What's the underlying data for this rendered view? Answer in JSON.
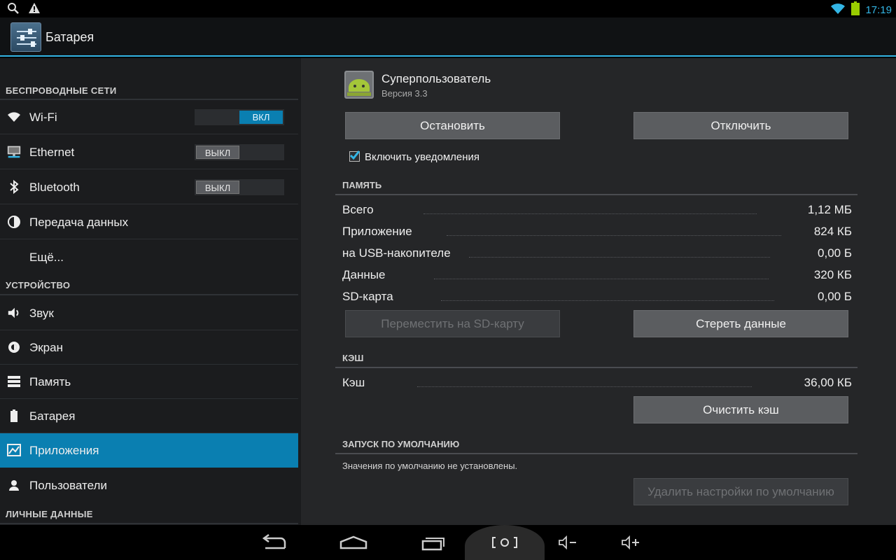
{
  "status_bar": {
    "left_icons": [
      "search-icon",
      "warning-icon"
    ],
    "right_icons": [
      "wifi-icon",
      "battery-icon"
    ],
    "time": "17:19",
    "accent": "#33b5e5"
  },
  "action_bar": {
    "title": "Батарея",
    "icon": "settings-sliders-icon"
  },
  "sidebar": {
    "sections": {
      "wireless": "БЕСПРОВОДНЫЕ СЕТИ",
      "device": "УСТРОЙСТВО",
      "personal": "ЛИЧНЫЕ ДАННЫЕ"
    },
    "items": [
      {
        "label": "Wi-Fi",
        "icon": "wifi-icon",
        "toggle": "ВКЛ",
        "toggle_state": "on"
      },
      {
        "label": "Ethernet",
        "icon": "ethernet-icon",
        "toggle": "ВЫКЛ",
        "toggle_state": "off"
      },
      {
        "label": "Bluetooth",
        "icon": "bluetooth-icon",
        "toggle": "ВЫКЛ",
        "toggle_state": "off"
      },
      {
        "label": "Передача данных",
        "icon": "data-usage-icon"
      },
      {
        "label": "Ещё..."
      },
      {
        "label": "Звук",
        "icon": "speaker-icon"
      },
      {
        "label": "Экран",
        "icon": "brightness-icon"
      },
      {
        "label": "Память",
        "icon": "storage-icon"
      },
      {
        "label": "Батарея",
        "icon": "battery-icon"
      },
      {
        "label": "Приложения",
        "icon": "apps-icon",
        "active": true
      },
      {
        "label": "Пользователи",
        "icon": "user-icon"
      }
    ],
    "active_color": "#0a7fb1"
  },
  "app_details": {
    "name": "Суперпользователь",
    "version": "Версия 3.3",
    "icon": "android-superuser-icon",
    "buttons": {
      "stop": "Остановить",
      "disable": "Отключить",
      "move_sd": "Переместить на SD-карту",
      "clear_data": "Стереть данные",
      "clear_cache": "Очистить кэш",
      "clear_defaults": "Удалить настройки по умолчанию"
    },
    "notifications": {
      "label": "Включить уведомления",
      "checked": true
    },
    "memory": {
      "header": "ПАМЯТЬ",
      "rows": [
        {
          "label": "Всего",
          "value": "1,12 МБ"
        },
        {
          "label": "Приложение",
          "value": "824 КБ"
        },
        {
          "label": "на USB-накопителе",
          "value": "0,00 Б"
        },
        {
          "label": "Данные",
          "value": "320 КБ"
        },
        {
          "label": "SD-карта",
          "value": "0,00 Б"
        }
      ]
    },
    "cache": {
      "header": "КЭШ",
      "rows": [
        {
          "label": "Кэш",
          "value": "36,00 КБ"
        }
      ]
    },
    "launch_default": {
      "header": "ЗАПУСК ПО УМОЛЧАНИЮ",
      "text": "Значения по умолчанию не установлены."
    }
  },
  "nav_bar": {
    "buttons": [
      "back-icon",
      "home-icon",
      "recent-apps-icon",
      "screenshot-icon",
      "volume-down-icon",
      "volume-up-icon"
    ]
  }
}
